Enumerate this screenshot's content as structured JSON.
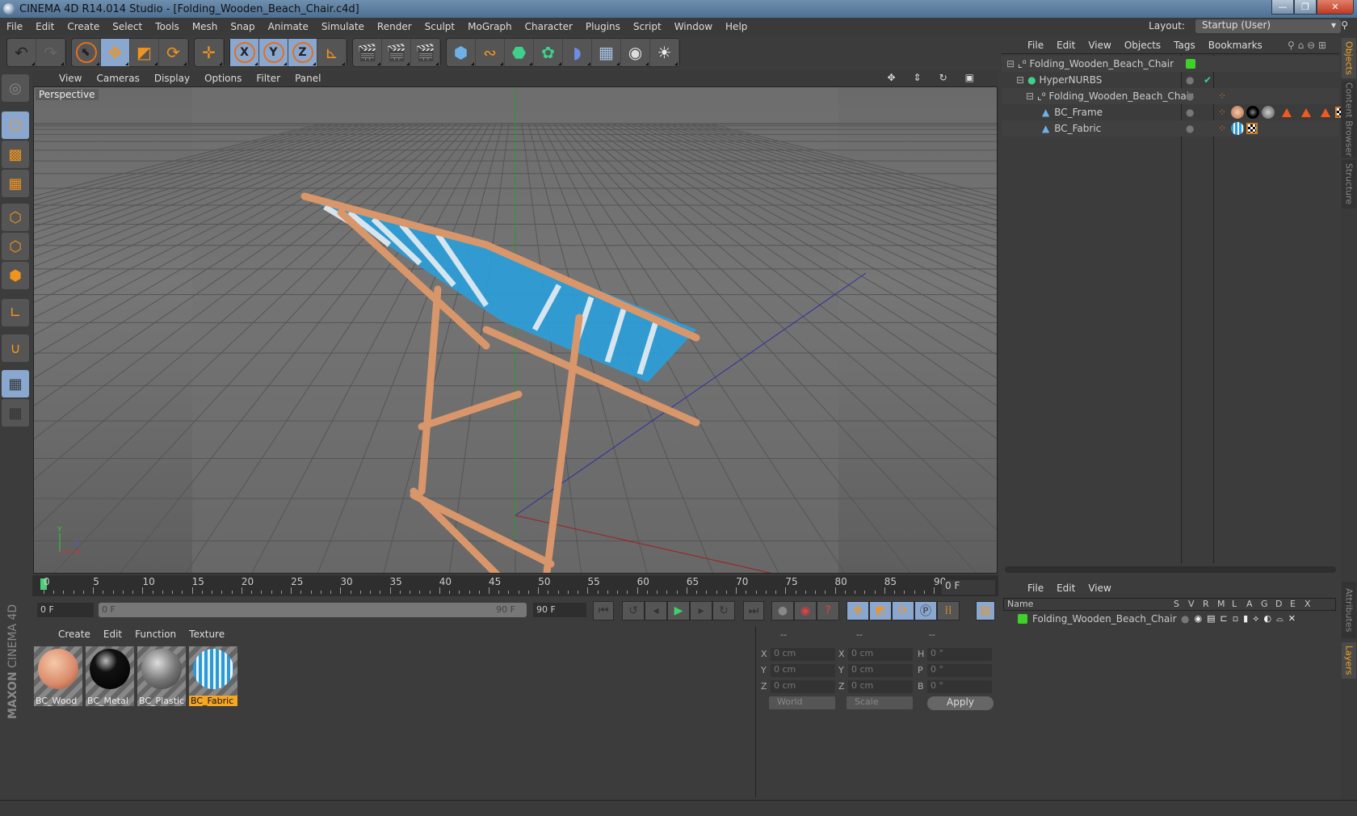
{
  "window": {
    "title": "CINEMA 4D R14.014 Studio - [Folding_Wooden_Beach_Chair.c4d]",
    "min": "—",
    "max": "❐",
    "close": "✕"
  },
  "menubar": [
    "File",
    "Edit",
    "Create",
    "Select",
    "Tools",
    "Mesh",
    "Snap",
    "Animate",
    "Simulate",
    "Render",
    "Sculpt",
    "MoGraph",
    "Character",
    "Plugins",
    "Script",
    "Window",
    "Help"
  ],
  "layout": {
    "label": "Layout:",
    "value": "Startup (User)"
  },
  "toolbar": {
    "undo": [
      "undo-icon",
      "redo-icon"
    ],
    "modes": [
      {
        "icon": "live-selection-icon",
        "glyph": "⬉",
        "active": false
      },
      {
        "icon": "move-icon",
        "glyph": "✥",
        "active": true
      },
      {
        "icon": "scale-icon",
        "glyph": "◩",
        "active": false
      },
      {
        "icon": "rotate-icon",
        "glyph": "⟳",
        "active": false
      }
    ],
    "add": {
      "icon": "add-icon",
      "glyph": "✛"
    },
    "axes": [
      "X",
      "Y",
      "Z"
    ],
    "render": [
      "render-view-icon",
      "render-picture-viewer-icon",
      "render-settings-icon"
    ],
    "objects": [
      {
        "icon": "cube-icon",
        "glyph": "⬢",
        "color": "#6fb1e6"
      },
      {
        "icon": "spline-icon",
        "glyph": "∾",
        "color": "#f0941e"
      },
      {
        "icon": "nurbs-icon",
        "glyph": "⬣",
        "color": "#3fd18a"
      },
      {
        "icon": "array-icon",
        "glyph": "✿",
        "color": "#3fd18a"
      },
      {
        "icon": "deformer-icon",
        "glyph": "◗",
        "color": "#6c8de0"
      },
      {
        "icon": "floor-icon",
        "glyph": "▦",
        "color": "#a7c4e8"
      },
      {
        "icon": "camera-icon",
        "glyph": "🎥",
        "color": "#ddd"
      },
      {
        "icon": "light-icon",
        "glyph": "💡",
        "color": "#eee"
      }
    ]
  },
  "left_tools": [
    {
      "icon": "make-editable-icon",
      "glyph": "◎",
      "active": false
    },
    {
      "icon": "model-mode-icon",
      "glyph": "⬡",
      "active": true
    },
    {
      "icon": "texture-mode-icon",
      "glyph": "▩",
      "active": false
    },
    {
      "icon": "workplane-mode-icon",
      "glyph": "▦",
      "active": false
    },
    {
      "icon": "points-mode-icon",
      "glyph": "⬡",
      "active": false
    },
    {
      "icon": "edges-mode-icon",
      "glyph": "⬡",
      "active": false
    },
    {
      "icon": "polygons-mode-icon",
      "glyph": "⬡",
      "active": false
    },
    {
      "icon": "axis-mode-icon",
      "glyph": "∟",
      "active": false
    },
    {
      "icon": "snap-magnet-icon",
      "glyph": "∪",
      "active": false
    },
    {
      "icon": "workplane-lock-icon",
      "glyph": "▦",
      "active": true
    },
    {
      "icon": "workplane-rotate-icon",
      "glyph": "▦",
      "active": false
    }
  ],
  "brand": {
    "line1": "MAXON",
    "line2": "CINEMA 4D"
  },
  "viewport": {
    "menu": [
      "View",
      "Cameras",
      "Display",
      "Options",
      "Filter",
      "Panel"
    ],
    "label": "Perspective",
    "nav_icons": [
      "move-view-icon",
      "zoom-view-icon",
      "rotate-view-icon",
      "maximize-view-icon"
    ]
  },
  "timeline": {
    "ticks": [
      "0",
      "5",
      "10",
      "15",
      "20",
      "25",
      "30",
      "35",
      "40",
      "45",
      "50",
      "55",
      "60",
      "65",
      "70",
      "75",
      "80",
      "85",
      "90"
    ],
    "current_frame": "0 F",
    "start_field": "0 F",
    "range_start": "0 F",
    "range_end": "90 F",
    "end_field": "90 F"
  },
  "transport": [
    "go-to-start-icon",
    "go-to-previous-keyframe-icon",
    "previous-frame-icon",
    "play-icon",
    "next-frame-icon",
    "go-to-next-keyframe-icon",
    "go-to-end-icon",
    "record-icon",
    "autokey-icon",
    "keyframe-help-icon",
    "key-position-icon",
    "key-scale-icon",
    "key-rotation-icon",
    "key-param-icon",
    "key-pla-icon",
    "timeline-icon"
  ],
  "materials": {
    "menu": [
      "Create",
      "Edit",
      "Function",
      "Texture"
    ],
    "items": [
      {
        "name": "BC_Wood",
        "selected": false,
        "color": "#e0a07a"
      },
      {
        "name": "BC_Metal",
        "selected": false,
        "color": "#111111"
      },
      {
        "name": "BC_Plastic",
        "selected": false,
        "color": "#888888"
      },
      {
        "name": "BC_Fabric",
        "selected": true,
        "color": "#2a9ad8"
      }
    ]
  },
  "coords": {
    "headers": [
      "--",
      "--",
      "--"
    ],
    "rows": [
      {
        "a": "X",
        "av": "0 cm",
        "b": "X",
        "bv": "0 cm",
        "c": "H",
        "cv": "0 °"
      },
      {
        "a": "Y",
        "av": "0 cm",
        "b": "Y",
        "bv": "0 cm",
        "c": "P",
        "cv": "0 °"
      },
      {
        "a": "Z",
        "av": "0 cm",
        "b": "Z",
        "bv": "0 cm",
        "c": "B",
        "cv": "0 °"
      }
    ],
    "space": "World",
    "mode": "Scale",
    "apply": "Apply"
  },
  "object_manager": {
    "menu": [
      "File",
      "Edit",
      "View",
      "Objects",
      "Tags",
      "Bookmarks"
    ],
    "objects": [
      {
        "name": "Folding_Wooden_Beach_Chair",
        "indent": 0,
        "icon": "null-icon",
        "layer_color": "#3fd12a"
      },
      {
        "name": "HyperNURBS",
        "indent": 1,
        "icon": "hypernurbs-icon",
        "check": "✔"
      },
      {
        "name": "Folding_Wooden_Beach_Chair",
        "indent": 2,
        "icon": "null-icon"
      },
      {
        "name": "BC_Frame",
        "indent": 3,
        "icon": "polygon-object-icon"
      },
      {
        "name": "BC_Fabric",
        "indent": 3,
        "icon": "polygon-object-icon"
      }
    ]
  },
  "right_tabs": {
    "top": [
      "Objects",
      "Content Browser",
      "Structure"
    ],
    "bottom": [
      "Attributes",
      "Layers"
    ]
  },
  "layer_manager": {
    "menu": [
      "File",
      "Edit",
      "View"
    ],
    "columns": [
      "Name",
      "S",
      "V",
      "R",
      "M",
      "L",
      "A",
      "G",
      "D",
      "E",
      "X"
    ],
    "layers": [
      {
        "name": "Folding_Wooden_Beach_Chair",
        "color": "#3fd12a"
      }
    ]
  }
}
